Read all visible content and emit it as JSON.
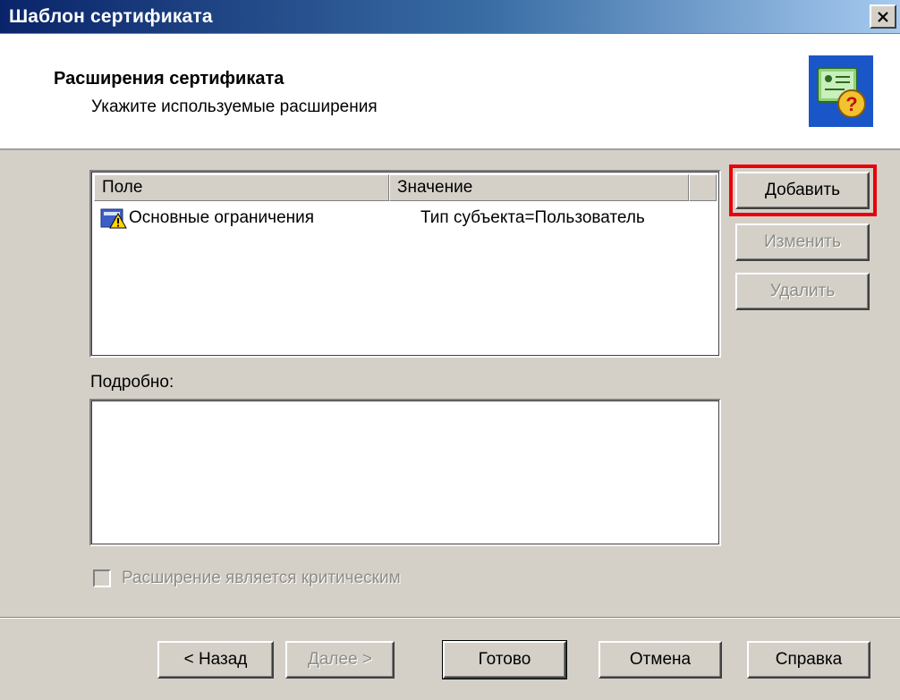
{
  "window": {
    "title": "Шаблон сертификата"
  },
  "header": {
    "title": "Расширения сертификата",
    "subtitle": "Укажите используемые расширения",
    "icon": "certificate-question-icon"
  },
  "extensions_list": {
    "columns": [
      "Поле",
      "Значение",
      ""
    ],
    "rows": [
      {
        "field": "Основные ограничения",
        "value": "Тип субъекта=Пользователь",
        "icon": "certificate-warning-icon"
      }
    ]
  },
  "side_buttons": {
    "add": "Добавить",
    "edit": "Изменить",
    "delete": "Удалить"
  },
  "details": {
    "label": "Подробно:",
    "value": ""
  },
  "critical_checkbox": {
    "label": "Расширение является критическим",
    "checked": false,
    "enabled": false
  },
  "nav_buttons": {
    "back": "< Назад",
    "next": "Далее >",
    "finish": "Готово",
    "cancel": "Отмена",
    "help": "Справка"
  },
  "colors": {
    "highlight": "#e8000b",
    "titlebar": "#0a246a",
    "dialog_bg": "#d4d0c8"
  }
}
